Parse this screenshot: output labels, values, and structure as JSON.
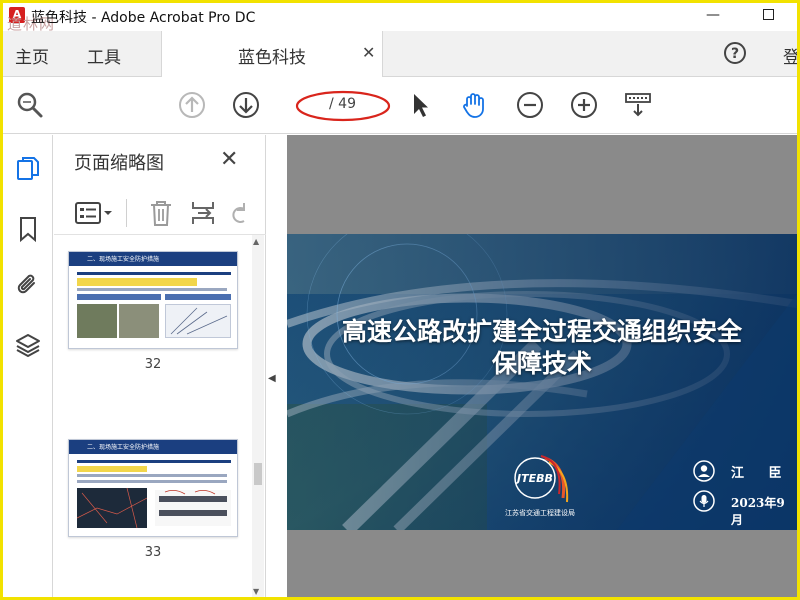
{
  "window": {
    "title": "蓝色科技 - Adobe Acrobat Pro DC",
    "minimize_label": "—",
    "watermark": "道林网"
  },
  "menubar": {
    "home_label": "主页",
    "tools_label": "工具",
    "document_tab_label": "蓝色科技",
    "sign_in_label": "登"
  },
  "toolbar": {
    "current_page": "",
    "page_total": "/ 49"
  },
  "thumbnail_panel": {
    "title": "页面缩略图",
    "thumbnails": [
      {
        "page_number": "32",
        "header_text": "二、现场施工安全防护措施"
      },
      {
        "page_number": "33",
        "header_text": "二、现场施工安全防护措施"
      }
    ]
  },
  "slide": {
    "title_line1": "高速公路改扩建全过程交通组织安全",
    "title_line2": "保障技术",
    "presenter": "江 臣",
    "date": "2023年9月",
    "logo_text": "JTEBB",
    "org_name": "江苏省交通工程建设局"
  },
  "colors": {
    "title_bar_border": "#f2e200",
    "accent_blue": "#1473e6",
    "annotation_red": "#d9251c",
    "slide_navy": "#0d3a6e",
    "document_background": "#8a8a8a"
  },
  "icons": {
    "tools_search": "magnifier-icon",
    "prev_page": "arrow-up-circle-icon",
    "next_page": "arrow-down-circle-icon",
    "select": "cursor-icon",
    "hand": "hand-icon",
    "zoom_out": "minus-circle-icon",
    "zoom_in": "plus-circle-icon",
    "keyboard": "keyboard-icon",
    "help": "help-icon",
    "page_thumbnails": "pages-icon",
    "bookmarks": "bookmark-icon",
    "attachments": "paperclip-icon",
    "layers": "layers-icon",
    "thumbnail_options": "list-options-icon",
    "delete": "trash-icon",
    "insert": "insert-page-icon",
    "undo": "undo-icon",
    "presenter": "person-icon",
    "date": "microphone-icon"
  }
}
